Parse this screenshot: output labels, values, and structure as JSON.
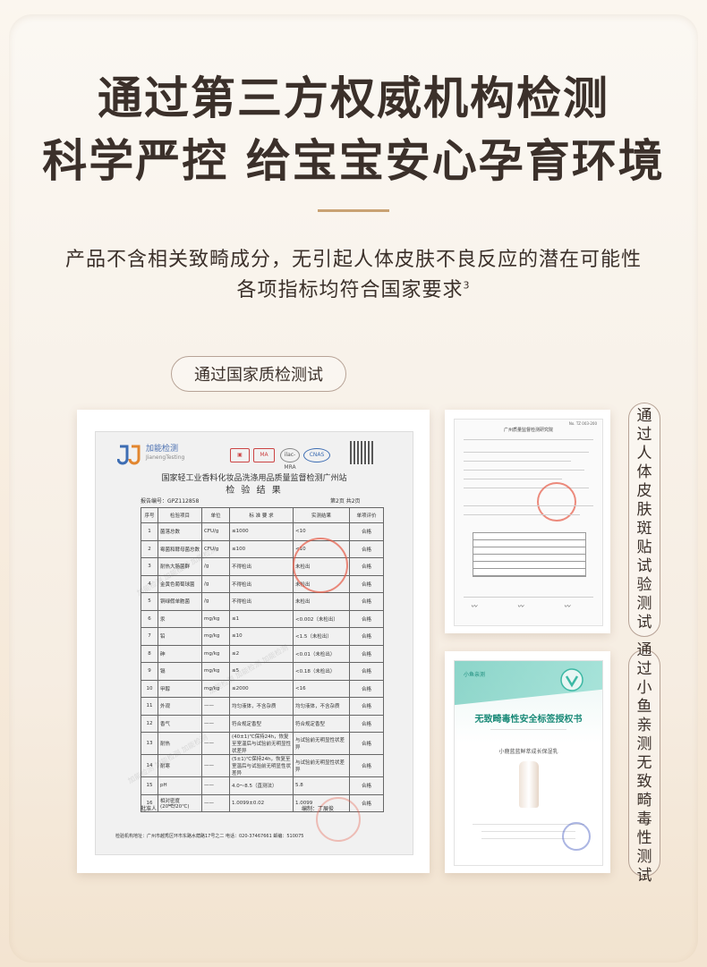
{
  "headline": {
    "line1": "通过第三方权威机构检测",
    "line2": "科学严控 给宝宝安心孕育环境"
  },
  "subtitle": {
    "line1": "产品不含相关致畸成分，无引起人体皮肤不良反应的潜在可能性",
    "line2": "各项指标均符合国家要求",
    "footnote": "3"
  },
  "badges": {
    "national": "通过国家质检测试",
    "skin_patch": [
      "通",
      "过",
      "人",
      "体",
      "皮",
      "肤",
      "斑",
      "贴",
      "试",
      "验",
      "测",
      "试"
    ],
    "fish": [
      "通",
      "过",
      "小",
      "鱼",
      "亲",
      "测",
      "无",
      "致",
      "畸",
      "毒",
      "性",
      "测",
      "试"
    ]
  },
  "report": {
    "logo_name": "加能检测",
    "logo_sub": "JianengTesting",
    "cert_marks": [
      "MA",
      "ilac-MRA",
      "CNAS"
    ],
    "org_title": "国家轻工业香料化妆品洗涤用品质量监督检测广州站",
    "doc_title": "检 验 结 果",
    "report_no": "报告编号：GPZ112858",
    "page": "第2页 共2页",
    "headers": [
      "序号",
      "检验项目",
      "单位",
      "标 准 要 求",
      "实测结果",
      "单项评价"
    ],
    "rows": [
      [
        "1",
        "菌落总数",
        "CFU/g",
        "≤1000",
        "<10",
        "合格"
      ],
      [
        "2",
        "霉菌和酵母菌总数",
        "CFU/g",
        "≤100",
        "<10",
        "合格"
      ],
      [
        "3",
        "耐热大肠菌群",
        "/g",
        "不得检出",
        "未检出",
        "合格"
      ],
      [
        "4",
        "金黄色葡萄球菌",
        "/g",
        "不得检出",
        "未检出",
        "合格"
      ],
      [
        "5",
        "铜绿假单胞菌",
        "/g",
        "不得检出",
        "未检出",
        "合格"
      ],
      [
        "6",
        "汞",
        "mg/kg",
        "≤1",
        "<0.002（未检出）",
        "合格"
      ],
      [
        "7",
        "铅",
        "mg/kg",
        "≤10",
        "<1.5（未检出）",
        "合格"
      ],
      [
        "8",
        "砷",
        "mg/kg",
        "≤2",
        "<0.01（未检出）",
        "合格"
      ],
      [
        "9",
        "镉",
        "mg/kg",
        "≤5",
        "<0.18（未检出）",
        "合格"
      ],
      [
        "10",
        "甲醇",
        "mg/kg",
        "≤2000",
        "<16",
        "合格"
      ],
      [
        "11",
        "外观",
        "——",
        "均匀液体，不含杂质",
        "均匀液体，不含杂质",
        "合格"
      ],
      [
        "12",
        "香气",
        "——",
        "符合规定香型",
        "符合规定香型",
        "合格"
      ],
      [
        "13",
        "耐热",
        "——",
        "(40±1)℃保持24h，恢复至室温后与试验前无明显性状差异",
        "与试验前无明显性状差异",
        "合格"
      ],
      [
        "14",
        "耐寒",
        "——",
        "(5±1)℃保持24h，恢复至室温后与试验前无明显性状差异",
        "与试验前无明显性状差异",
        "合格"
      ],
      [
        "15",
        "pH",
        "——",
        "4.0～8.5（直测法）",
        "5.8",
        "合格"
      ],
      [
        "16",
        "相对密度(20℃/20℃)",
        "——",
        "1.0099±0.02",
        "1.0099",
        "合格"
      ]
    ],
    "approver": "批准人",
    "editor": "编制：丁展俊",
    "footer": "检验机构地址：广州市越秀区环市东路水荫路17号之二    电话：020-37467661    邮编：510075"
  },
  "patch_report": {
    "header": "广州质量监督检测研究院",
    "no": "No. TZ 003-200"
  },
  "fish_cert": {
    "brand": "小鱼亲测",
    "title": "无致畸毒性安全标签授权书",
    "product": "小鹿蓝蓝鲜萃成长保湿乳"
  }
}
